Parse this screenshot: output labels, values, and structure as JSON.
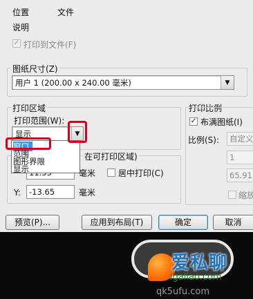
{
  "header": {
    "location_label": "位置",
    "location_value": "文件",
    "description_label": "说明",
    "print_to_file": "打印到文件(F)"
  },
  "paper": {
    "group_label": "图纸尺寸(Z)",
    "value": "用户 1 (200.00 x 240.00 毫米)"
  },
  "print_area": {
    "group_label": "打印区域",
    "range_label": "打印范围(W):",
    "selected": "显示",
    "options": [
      "窗口",
      "范围",
      "图形界限",
      "显示"
    ]
  },
  "offset": {
    "group_label_partial": "在可打印区域)",
    "x_value": "11.55",
    "x_unit": "毫米",
    "center_label": "居中打印(C)",
    "y_label": "Y:",
    "y_value": "-13.65",
    "y_unit": "毫米"
  },
  "scale": {
    "group_label": "打印比例",
    "fit_label": "布满图纸(I)",
    "ratio_label": "比例(S):",
    "ratio_value": "自定义",
    "field1": "1",
    "field2": "65.91",
    "scale_lw": "缩放"
  },
  "buttons": {
    "preview": "预览(P)...",
    "apply": "应用到布局(T)",
    "ok": "确定",
    "cancel": "取消"
  },
  "watermark": {
    "text": "爱私聊",
    "url": "igaliao.com",
    "url2": "qk5ufu.com"
  },
  "colors": {
    "highlight": "#3399ff",
    "annotation_red": "#d7001d"
  }
}
